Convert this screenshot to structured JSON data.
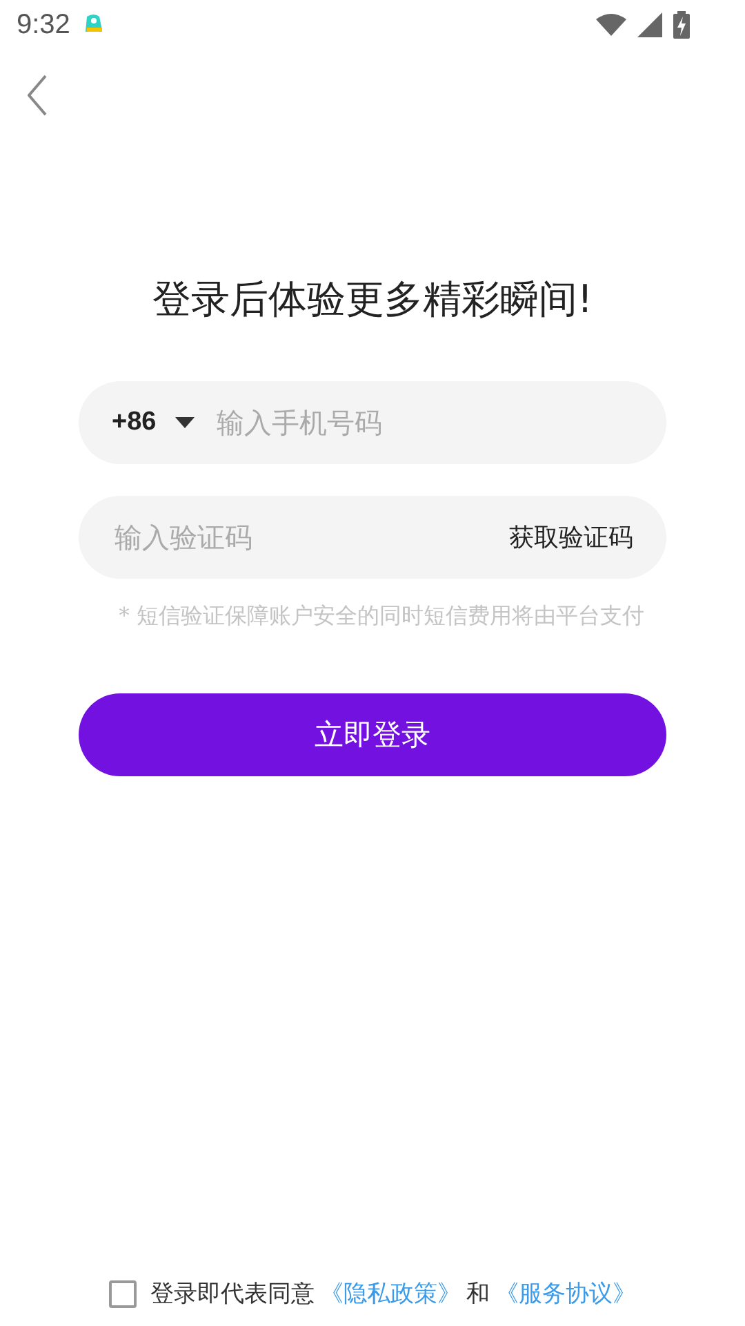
{
  "status_bar": {
    "time": "9:32"
  },
  "title": "登录后体验更多精彩瞬间!",
  "phone_field": {
    "country_code": "+86",
    "placeholder": "输入手机号码"
  },
  "code_field": {
    "placeholder": "输入验证码",
    "action": "获取验证码"
  },
  "hint": "* 短信验证保障账户安全的同时短信费用将由平台支付",
  "login_button": "立即登录",
  "agreement": {
    "checked": false,
    "text": "登录即代表同意",
    "links": [
      "《隐私政策》",
      "《服务协议》"
    ],
    "joiner": "和"
  }
}
